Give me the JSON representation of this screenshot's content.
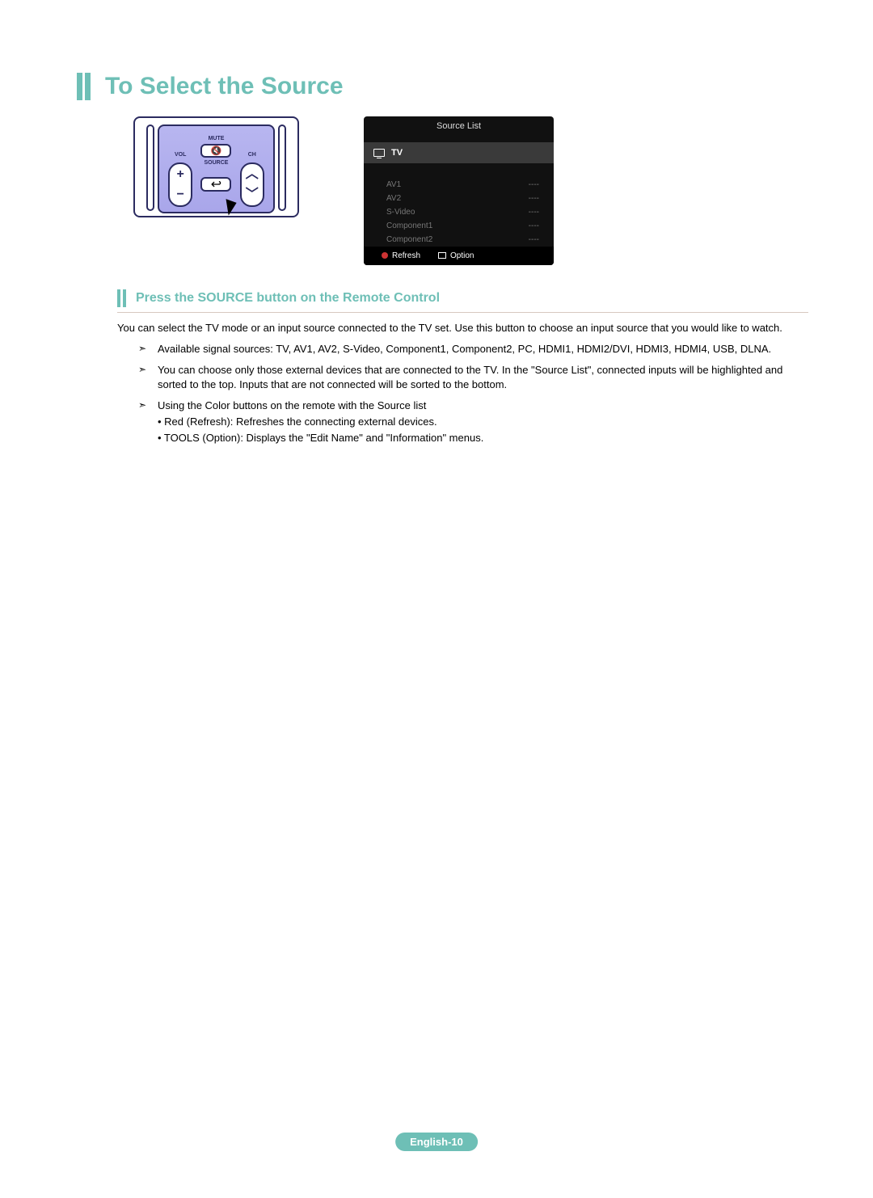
{
  "title": "To Select the Source",
  "remote": {
    "mute_label": "MUTE",
    "vol_label": "VOL",
    "source_label": "SOURCE",
    "ch_label": "CH",
    "mute_glyph": "🔇",
    "source_glyph": "↩",
    "plus": "+",
    "minus": "−",
    "up": "︿",
    "down": "﹀"
  },
  "osd": {
    "header": "Source List",
    "tv_label": "TV",
    "items": [
      {
        "name": "AV1",
        "status": "----"
      },
      {
        "name": "AV2",
        "status": "----"
      },
      {
        "name": "S-Video",
        "status": "----"
      },
      {
        "name": "Component1",
        "status": "----"
      },
      {
        "name": "Component2",
        "status": "----"
      }
    ],
    "refresh_label": "Refresh",
    "option_label": "Option"
  },
  "subheading": "Press the SOURCE button on the Remote Control",
  "intro": "You can select the TV mode or an input source connected to the TV set. Use this button to choose an input source that you would like to watch.",
  "bullets": [
    {
      "text": "Available signal sources: TV, AV1, AV2, S-Video, Component1, Component2, PC, HDMI1, HDMI2/DVI, HDMI3, HDMI4, USB, DLNA."
    },
    {
      "text": "You can choose only those external devices that are connected to the TV. In the \"Source List\", connected inputs will be highlighted and sorted to the top. Inputs that are not connected will be sorted to the bottom."
    },
    {
      "text": "Using the Color buttons on the remote with the Source list",
      "subs": [
        "• Red (Refresh): Refreshes the connecting external devices.",
        "• TOOLS (Option): Displays the \"Edit Name\" and \"Information\" menus."
      ]
    }
  ],
  "footer": "English-10"
}
